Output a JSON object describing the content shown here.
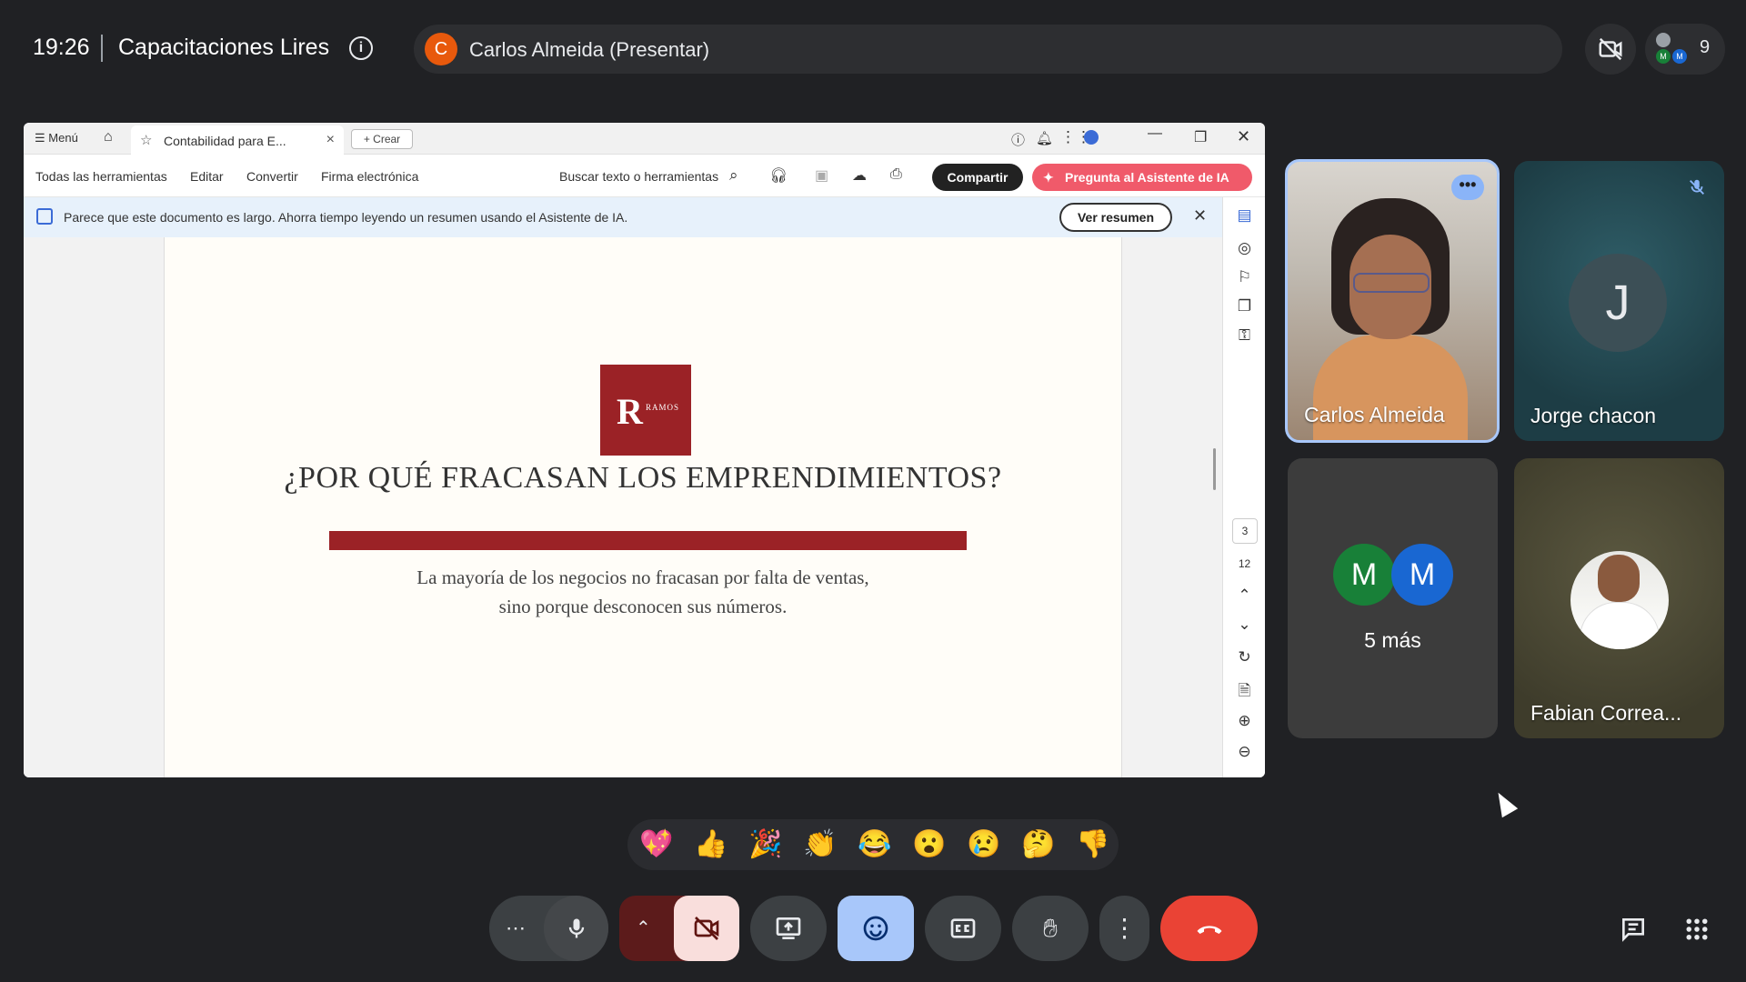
{
  "meeting": {
    "time": "19:26",
    "title": "Capacitaciones Lires",
    "presenter_initial": "C",
    "presenter_label": "Carlos Almeida (Presentar)",
    "participant_count": "9",
    "stack_initials": [
      "M",
      "M"
    ]
  },
  "shared_window": {
    "menu_label": "Menú",
    "tab_title": "Contabilidad para E...",
    "crear_label": "Crear",
    "toolbar": {
      "all_tools": "Todas las herramientas",
      "edit": "Editar",
      "convert": "Convertir",
      "esign": "Firma electrónica",
      "search": "Buscar texto o herramientas",
      "share": "Compartir",
      "ask_ai": "Pregunta al Asistente de IA"
    },
    "banner": {
      "text": "Parece que este documento es largo. Ahorra tiempo leyendo un resumen usando el Asistente de IA.",
      "button": "Ver resumen"
    },
    "document": {
      "logo_text": "RAMOS",
      "logo_letter": "R",
      "heading": "¿POR QUÉ FRACASAN LOS EMPRENDIMIENTOS?",
      "subtext_line1": "La mayoría de los negocios no fracasan por falta de ventas,",
      "subtext_line2": "sino porque desconocen sus números.",
      "current_page": "3",
      "total_pages": "12"
    }
  },
  "participants": [
    {
      "name": "Carlos Almeida"
    },
    {
      "name": "Jorge chacon",
      "initial": "J"
    },
    {
      "more_label": "5 más",
      "initials": [
        "M",
        "M"
      ]
    },
    {
      "name": "Fabian Correa..."
    }
  ],
  "reactions": [
    "💖",
    "👍",
    "🎉",
    "👏",
    "😂",
    "😮",
    "😢",
    "🤔",
    "👎"
  ],
  "colors": {
    "background": "#202124",
    "accent_blue": "#a8c7fa",
    "end_call": "#ea4335",
    "brand_red": "#9b2226",
    "ai_button": "#f05a6a"
  }
}
